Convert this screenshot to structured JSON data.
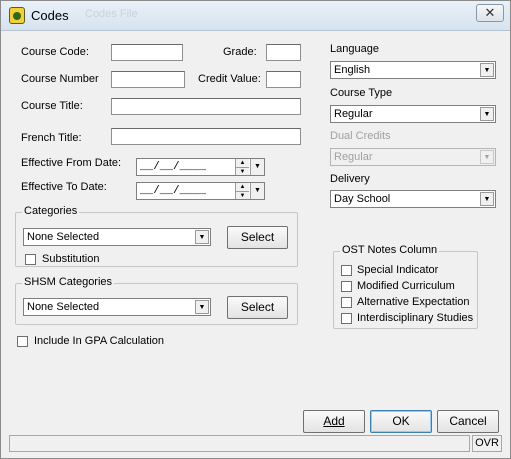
{
  "window": {
    "title": "Codes",
    "ghost_title": "Codes File",
    "close_glyph": "✕"
  },
  "left": {
    "course_code_label": "Course Code:",
    "grade_label": "Grade:",
    "course_number_label": "Course Number",
    "credit_value_label": "Credit Value:",
    "course_title_label": "Course Title:",
    "french_title_label": "French Title:",
    "effective_from_label": "Effective From Date:",
    "effective_from_value": "__/__/____",
    "effective_to_label": "Effective To Date:",
    "effective_to_value": "__/__/____"
  },
  "categories": {
    "title": "Categories",
    "selected": "None Selected",
    "select_button": "Select",
    "substitution_label": "Substitution",
    "substitution_checked": false
  },
  "shsm": {
    "title": "SHSM Categories",
    "selected": "None Selected",
    "select_button": "Select"
  },
  "gpa": {
    "label": "Include In GPA Calculation",
    "checked": false
  },
  "right": {
    "language_label": "Language",
    "language_value": "English",
    "course_type_label": "Course Type",
    "course_type_value": "Regular",
    "dual_credits_label": "Dual Credits",
    "dual_credits_value": "Regular",
    "delivery_label": "Delivery",
    "delivery_value": "Day School"
  },
  "ost": {
    "title": "OST Notes Column",
    "items": [
      {
        "label": "Special Indicator",
        "checked": false
      },
      {
        "label": "Modified Curriculum",
        "checked": false
      },
      {
        "label": "Alternative Expectation",
        "checked": false
      },
      {
        "label": "Interdisciplinary Studies",
        "checked": false
      }
    ]
  },
  "buttons": {
    "add": "Add",
    "ok": "OK",
    "cancel": "Cancel"
  },
  "status": {
    "mode": "OVR"
  },
  "icons": {
    "dropdown": "▼",
    "spin_up": "▲",
    "spin_down": "▼"
  }
}
